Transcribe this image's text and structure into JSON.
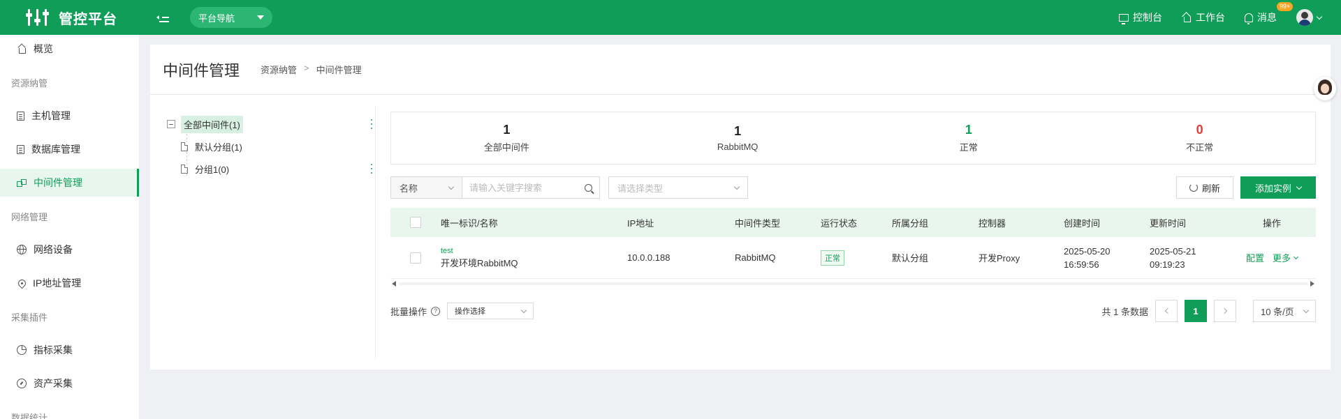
{
  "app": {
    "title": "管控平台",
    "nav_select": "平台导航",
    "top_links": {
      "console": "控制台",
      "workbench": "工作台",
      "messages": "消息",
      "message_badge": "99+"
    }
  },
  "sidebar": {
    "overview": "概览",
    "groups": {
      "resources": "资源纳管",
      "network": "网络管理",
      "plugins": "采集插件",
      "stats": "数据统计"
    },
    "items": {
      "hosts": "主机管理",
      "databases": "数据库管理",
      "middleware": "中间件管理",
      "network_devices": "网络设备",
      "ip_management": "IP地址管理",
      "metric_collect": "指标采集",
      "asset_collect": "资产采集"
    }
  },
  "page": {
    "title": "中间件管理",
    "breadcrumb": [
      "资源纳管",
      ">",
      "中间件管理"
    ]
  },
  "tree": {
    "root": "全部中间件(1)",
    "children": [
      "默认分组(1)",
      "分组1(0)"
    ]
  },
  "stats": [
    {
      "value": "1",
      "label": "全部中间件"
    },
    {
      "value": "1",
      "label": "RabbitMQ"
    },
    {
      "value": "1",
      "label": "正常"
    },
    {
      "value": "0",
      "label": "不正常"
    }
  ],
  "toolbar": {
    "field_select": "名称",
    "search_placeholder": "请输入关键字搜索",
    "type_placeholder": "请选择类型",
    "refresh_label": "刷新",
    "add_label": "添加实例"
  },
  "table": {
    "headers": [
      "唯一标识/名称",
      "IP地址",
      "中间件类型",
      "运行状态",
      "所属分组",
      "控制器",
      "创建时间",
      "更新时间",
      "操作"
    ],
    "rows": [
      {
        "id": "test",
        "name": "开发环境RabbitMQ",
        "ip": "10.0.0.188",
        "type": "RabbitMQ",
        "status": "正常",
        "group": "默认分组",
        "controller": "开发Proxy",
        "created_date": "2025-05-20",
        "created_time": "16:59:56",
        "updated_date": "2025-05-21",
        "updated_time": "09:19:23",
        "op_config": "配置",
        "op_more": "更多"
      }
    ]
  },
  "footer": {
    "bulk_label": "批量操作",
    "op_select": "操作选择",
    "total": "共 1 条数据",
    "current_page": "1",
    "page_size": "10 条/页"
  },
  "colors": {
    "brand": "#0f9d58",
    "danger": "#e53935"
  }
}
